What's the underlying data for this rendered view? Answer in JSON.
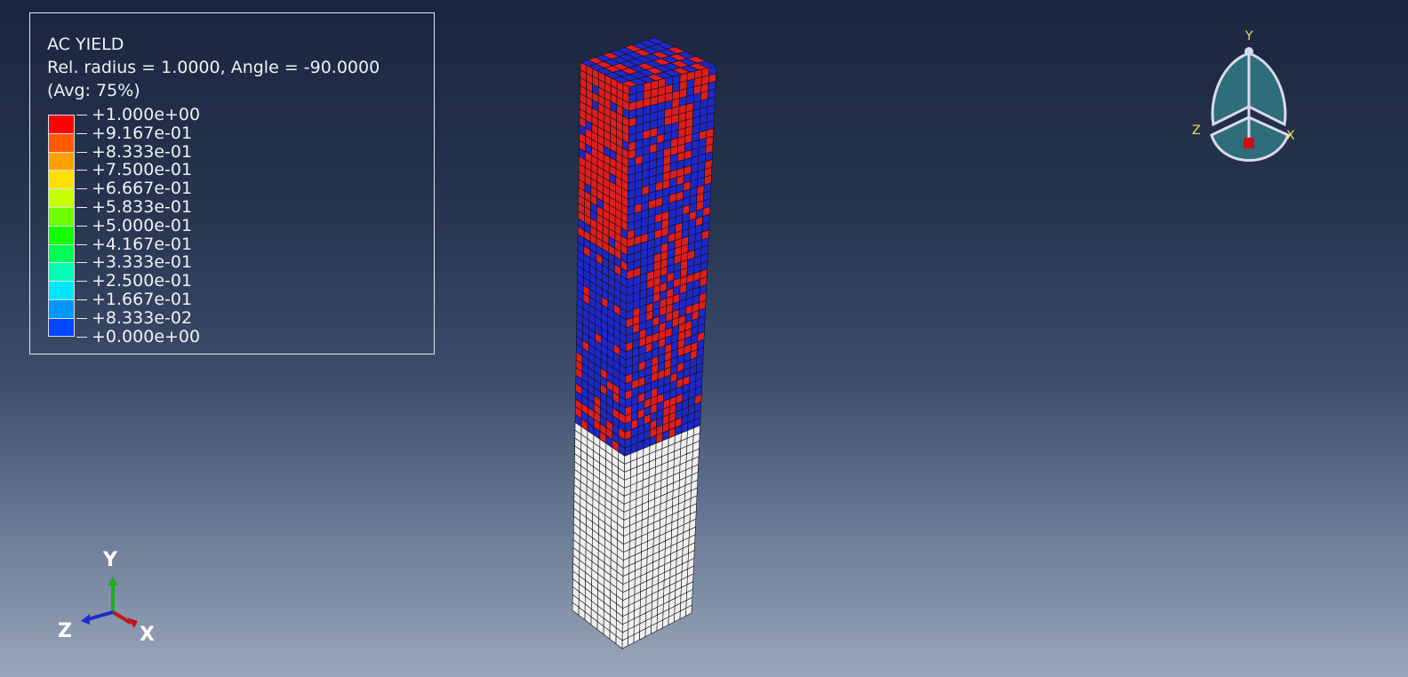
{
  "legend": {
    "title": "AC YIELD",
    "subtitle": "Rel. radius = 1.0000, Angle = -90.0000",
    "averaging": "(Avg: 75%)",
    "levels": [
      {
        "label": "+1.000e+00",
        "color": "#ff0000"
      },
      {
        "label": "+9.167e-01",
        "color": "#ff5a00"
      },
      {
        "label": "+8.333e-01",
        "color": "#ffa000"
      },
      {
        "label": "+7.500e-01",
        "color": "#ffe000"
      },
      {
        "label": "+6.667e-01",
        "color": "#c8ff00"
      },
      {
        "label": "+5.833e-01",
        "color": "#6eff00"
      },
      {
        "label": "+5.000e-01",
        "color": "#14ff00"
      },
      {
        "label": "+4.167e-01",
        "color": "#00ff50"
      },
      {
        "label": "+3.333e-01",
        "color": "#00ffb4"
      },
      {
        "label": "+2.500e-01",
        "color": "#00e6ff"
      },
      {
        "label": "+1.667e-01",
        "color": "#0096ff"
      },
      {
        "label": "+8.333e-02",
        "color": "#0046ff"
      },
      {
        "label": "+0.000e+00",
        "color": "#0000ff"
      }
    ]
  },
  "triad_bottom": {
    "x": "X",
    "y": "Y",
    "z": "Z"
  },
  "triad_top": {
    "x": "X",
    "y": "Y",
    "z": "Z"
  },
  "model": {
    "colors": {
      "yielded": "#dc1e1e",
      "elastic": "#1e28c8",
      "unloaded": "#f0f0f0",
      "edge": "#111111"
    }
  }
}
